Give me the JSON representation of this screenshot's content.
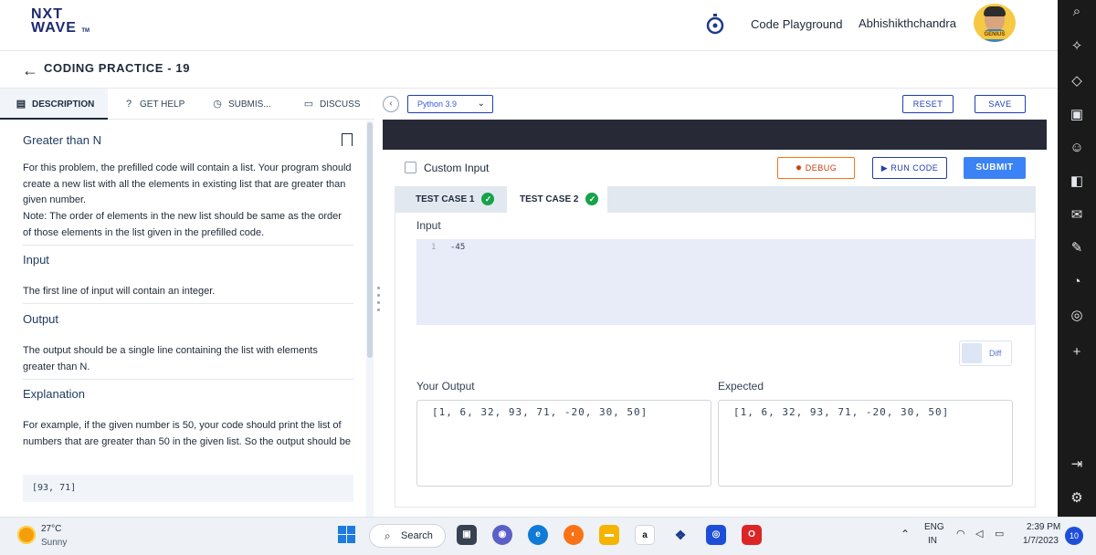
{
  "header": {
    "logo_line1": "NXT",
    "logo_line2": "WAVE",
    "logo_tm": "TM",
    "playground_label": "Code Playground",
    "username": "Abhishikthchandra",
    "avatar_badge": "GENIUS"
  },
  "page": {
    "title": "CODING PRACTICE - 19"
  },
  "left_tabs": [
    {
      "label": "DESCRIPTION",
      "icon": "description-icon",
      "active": true
    },
    {
      "label": "GET HELP",
      "icon": "help-circle-icon"
    },
    {
      "label": "SUBMIS...",
      "icon": "clock-icon"
    },
    {
      "label": "DISCUSS",
      "icon": "chat-icon"
    }
  ],
  "description": {
    "title": "Greater than N",
    "intro": "For this problem, the prefilled code will contain a list. Your program should create a new list with all the elements in existing list that are greater than given number.",
    "note": "Note: The order of elements in the new list should be same as the order of those elements in the list given in the prefilled code.",
    "input_heading": "Input",
    "input_text": "The first line of input will contain an integer.",
    "output_heading": "Output",
    "output_text": "The output should be a single line containing the list with elements greater than N.",
    "explanation_heading": "Explanation",
    "explanation_text": "For example, if the given number is 50, your code should print the list of numbers that are greater than 50 in the given list. So the output should be",
    "example_output": "[93, 71]"
  },
  "editor": {
    "language": "Python 3.9",
    "reset_label": "RESET",
    "save_label": "SAVE"
  },
  "run_panel": {
    "custom_input_label": "Custom Input",
    "debug_label": "DEBUG",
    "run_label": "RUN CODE",
    "submit_label": "SUBMIT",
    "test_cases": [
      {
        "label": "TEST CASE 1",
        "passed": true
      },
      {
        "label": "TEST CASE 2",
        "passed": true,
        "active": true
      }
    ],
    "input_label": "Input",
    "input_line_number": "1",
    "input_value": "-45",
    "diff_label": "Diff",
    "your_output_label": "Your Output",
    "your_output_value": "[1, 6, 32, 93, 71, -20, 30, 50]",
    "expected_label": "Expected",
    "expected_value": "[1, 6, 32, 93, 71, -20, 30, 50]"
  },
  "right_sidebar_icons": [
    "search-icon",
    "sparkle-icon",
    "tag-icon",
    "toolbox-icon",
    "people-icon",
    "office-icon",
    "outlook-icon",
    "edit-icon",
    "bell-icon",
    "instagram-icon",
    "plus-icon",
    "panel-icon",
    "settings-icon"
  ],
  "taskbar": {
    "temperature": "27°C",
    "weather": "Sunny",
    "search_label": "Search",
    "language_line1": "ENG",
    "language_line2": "IN",
    "time": "2:39 PM",
    "date": "1/7/2023",
    "notification_count": "10"
  },
  "colors": {
    "brand": "#1e2b6f",
    "primary": "#3b82f6",
    "debug": "#f97316",
    "success": "#16a34a",
    "editor_dark": "#272a36"
  }
}
